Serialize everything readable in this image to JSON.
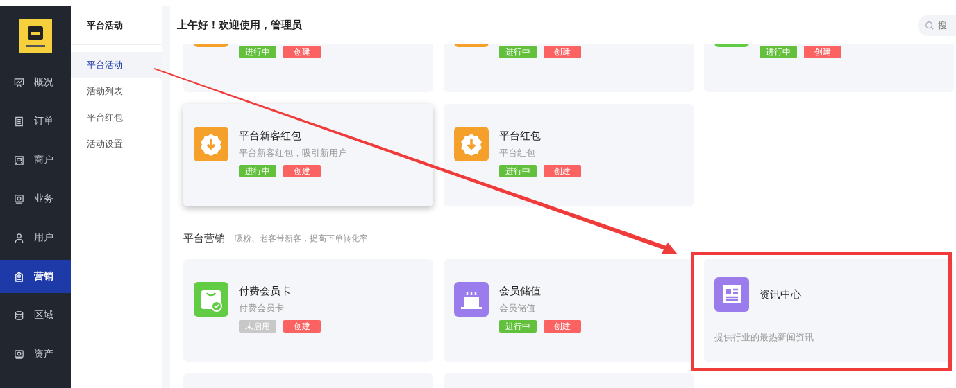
{
  "nav": {
    "items": [
      {
        "label": "概况",
        "kind": "chart",
        "selected": false
      },
      {
        "label": "订单",
        "kind": "list",
        "selected": false
      },
      {
        "label": "商户",
        "kind": "shop",
        "selected": false
      },
      {
        "label": "业务",
        "kind": "card",
        "selected": false
      },
      {
        "label": "用户",
        "kind": "user",
        "selected": false
      },
      {
        "label": "营销",
        "kind": "tag",
        "selected": true
      },
      {
        "label": "区域",
        "kind": "stack",
        "selected": false
      },
      {
        "label": "资产",
        "kind": "card",
        "selected": false
      }
    ]
  },
  "subnav": {
    "title": "平台活动",
    "items": [
      {
        "label": "平台活动",
        "selected": true
      },
      {
        "label": "活动列表",
        "selected": false
      },
      {
        "label": "平台红包",
        "selected": false
      },
      {
        "label": "活动设置",
        "selected": false
      }
    ]
  },
  "header": {
    "greeting": "上午好！欢迎使用，管理员",
    "search": {
      "placeholder": "搜"
    }
  },
  "sections": [
    {
      "cards": [
        {
          "kind": "badge",
          "color": "#f5a02a",
          "status": {
            "label": "进行中",
            "active": true
          },
          "action": "创建"
        },
        {
          "kind": "badge",
          "color": "#f5a02a",
          "status": {
            "label": "进行中",
            "active": true
          },
          "action": "创建"
        },
        {
          "kind": "bag",
          "color": "#62cc45",
          "status": {
            "label": "进行中",
            "active": true
          },
          "action": "创建"
        },
        {
          "kind": "badge",
          "color": "#f5a02a",
          "title": "平台新客红包",
          "description": "平台新客红包，吸引新用户",
          "raised": true,
          "status": {
            "label": "进行中",
            "active": true
          },
          "action": "创建"
        },
        {
          "kind": "badge",
          "color": "#f5a02a",
          "title": "平台红包",
          "description": "平台红包",
          "raised": false,
          "status": {
            "label": "进行中",
            "active": true
          },
          "action": "创建"
        }
      ]
    },
    {
      "title": "平台营销",
      "subtitle": "吸粉、老客带新客，提高下单转化率",
      "cards": [
        {
          "kind": "bag",
          "color": "#62cc45",
          "title": "付费会员卡",
          "description": "付费会员卡",
          "raised": false,
          "status": {
            "label": "未启用",
            "active": false
          },
          "action": "创建"
        },
        {
          "kind": "cake",
          "color": "#9b7ced",
          "title": "会员储值",
          "description": "会员储值",
          "raised": false,
          "status": {
            "label": "进行中",
            "active": true
          },
          "action": "创建"
        },
        {
          "kind": "news",
          "color": "#9b7ced",
          "title": "资讯中心",
          "description": "提供行业的最热新闻资讯"
        },
        {
          "kind": "blank"
        },
        {
          "kind": "blank"
        }
      ]
    }
  ]
}
